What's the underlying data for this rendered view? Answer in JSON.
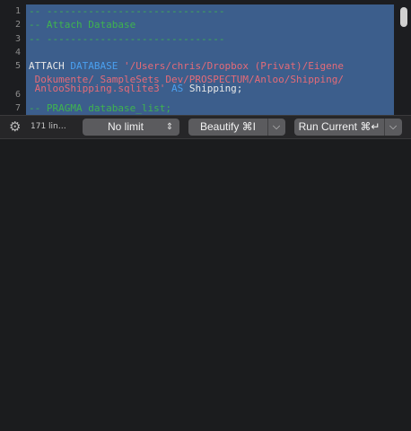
{
  "editor": {
    "line_numbers": [
      "1",
      "2",
      "3",
      "4",
      "5",
      "",
      "",
      "6",
      "7"
    ],
    "lines": [
      {
        "parts": [
          {
            "cls": "cm",
            "text": "-- ------------------------------"
          }
        ]
      },
      {
        "parts": [
          {
            "cls": "cm",
            "text": "-- Attach Database"
          }
        ]
      },
      {
        "parts": [
          {
            "cls": "cm",
            "text": "-- ------------------------------"
          }
        ]
      },
      {
        "parts": []
      },
      {
        "parts": [
          {
            "cls": "tx",
            "text": "ATTACH "
          },
          {
            "cls": "kw",
            "text": "DATABASE "
          },
          {
            "cls": "st",
            "text": "'/Users/chris/Dropbox (Privat)/Eigene"
          }
        ]
      },
      {
        "parts": [
          {
            "cls": "st",
            "text": " Dokumente/ SampleSets Dev/PROSPECTUM/Anloo/Shipping/"
          }
        ]
      },
      {
        "parts": [
          {
            "cls": "st",
            "text": " AnlooShipping.sqlite3' "
          },
          {
            "cls": "kw",
            "text": "AS "
          },
          {
            "cls": "tx",
            "text": "Shipping;"
          }
        ]
      },
      {
        "parts": []
      },
      {
        "parts": [
          {
            "cls": "cm",
            "text": "-- PRAGMA database_list;"
          }
        ]
      }
    ]
  },
  "toolbar": {
    "gear_icon": "gear-icon",
    "lines_info": "171 lin…",
    "limit_select": {
      "value": "No limit",
      "icon": "updown-chevron-icon"
    },
    "beautify_button": {
      "label": "Beautify ⌘I",
      "icon": "chevron-down-icon"
    },
    "run_button": {
      "label": "Run Current ⌘↵",
      "icon": "chevron-down-icon"
    }
  },
  "colors": {
    "background": "#1b1c1e",
    "selection": "#3c5e8c",
    "comment": "#3fb34f",
    "keyword": "#4aa0f0",
    "string": "#e46b78",
    "button": "#5b5b5e"
  }
}
